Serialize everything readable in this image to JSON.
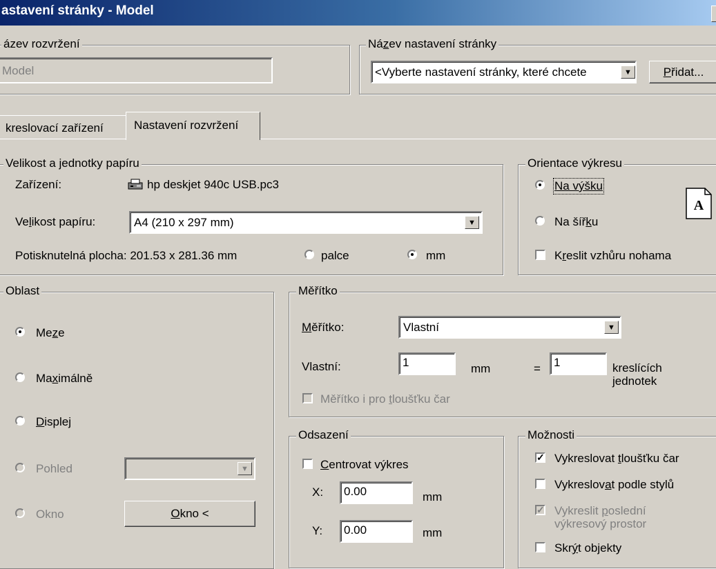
{
  "window": {
    "title": "astavení stránky - Model"
  },
  "layout_name": {
    "group_label": "ázev rozvržení",
    "value": "Model"
  },
  "page_setup_name": {
    "group_label_prefix": "Ná",
    "group_label_hot": "z",
    "group_label_suffix": "ev nastavení stránky",
    "select_value": "<Vyberte nastavení stránky, které chcete",
    "add_button_hot": "P",
    "add_button_rest": "řidat..."
  },
  "tabs": {
    "plot_device": "kreslovací zařízení",
    "layout_settings": "Nastavení rozvržení"
  },
  "paper": {
    "group_label": "Velikost  a jednotky papíru",
    "device_label": "Zařízení:",
    "device_value": "hp deskjet 940c USB.pc3",
    "size_label_pre": "Ve",
    "size_label_hot": "l",
    "size_label_post": "ikost papíru:",
    "size_value": "A4 (210 x 297 mm)",
    "printable_area": "Potisknutelná plocha: 201.53 x 281.36 mm",
    "unit_inches": "palce",
    "unit_mm": "mm",
    "selected_unit": "mm"
  },
  "orientation": {
    "group_label": "Orientace výkresu",
    "portrait": "Na výšku",
    "landscape_pre": "Na šíř",
    "landscape_hot": "k",
    "landscape_post": "u",
    "upside_down_pre": "K",
    "upside_down_hot": "r",
    "upside_down_post": "eslit vzhůru nohama",
    "preview_glyph": "A",
    "selected": "portrait"
  },
  "area": {
    "group_label": "Oblast",
    "limits_pre": "Me",
    "limits_hot": "z",
    "limits_post": "e",
    "extents_pre": "Ma",
    "extents_hot": "x",
    "extents_post": "imálně",
    "display_hot": "D",
    "display_post": "isplej",
    "view": "Pohled",
    "window": "Okno",
    "window_button_hot": "O",
    "window_button_post": "kno <",
    "selected": "limits"
  },
  "scale": {
    "group_label": "Měřítko",
    "scale_label_hot": "M",
    "scale_label_post": "ěřítko:",
    "scale_value": "Vlastní",
    "custom_label": "Vlastní:",
    "custom_mm": "1",
    "unit_mm": "mm",
    "equals": "=",
    "custom_units": "1",
    "units_line1": "kreslících",
    "units_line2": "jednotek",
    "lineweights_pre": "Měřítko i pro ",
    "lineweights_hot": "t",
    "lineweights_post": "loušťku čar"
  },
  "offset": {
    "group_label": "Odsazení",
    "center_hot": "C",
    "center_post": "entrovat výkres",
    "x_label": "X:",
    "x_value": "0.00",
    "y_label": "Y:",
    "y_value": "0.00",
    "unit": "mm"
  },
  "options": {
    "group_label": "Možnosti",
    "opt1_pre": "Vykreslovat ",
    "opt1_hot": "t",
    "opt1_post": "loušťku čar",
    "opt2_pre": "Vykreslov",
    "opt2_hot": "a",
    "opt2_post": "t podle stylů",
    "opt3_pre": "Vykreslit ",
    "opt3_hot": "p",
    "opt3_post": "oslední",
    "opt3_line2": "výkresový prostor",
    "opt4_pre": "Skr",
    "opt4_hot": "ý",
    "opt4_post": "t objekty",
    "checked": [
      true,
      false,
      true,
      false
    ]
  },
  "colors": {
    "face": "#d4d0c8",
    "title_start": "#0a246a",
    "title_end": "#a6caf0"
  }
}
